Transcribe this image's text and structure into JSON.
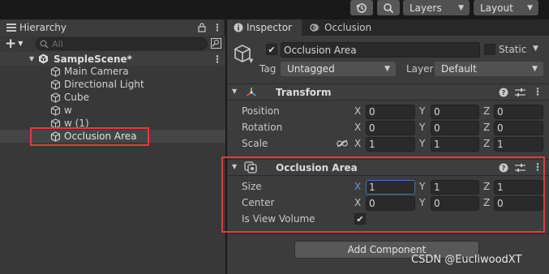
{
  "toolbar": {
    "history_icon": "history-icon",
    "search_icon": "search-icon",
    "layers_label": "Layers",
    "layout_label": "Layout"
  },
  "hierarchy": {
    "tab_label": "Hierarchy",
    "search_placeholder": "All",
    "scene_name": "SampleScene*",
    "items": [
      {
        "label": "Main Camera"
      },
      {
        "label": "Directional Light"
      },
      {
        "label": "Cube"
      },
      {
        "label": "w"
      },
      {
        "label": "w (1)"
      },
      {
        "label": "Occlusion Area"
      }
    ]
  },
  "inspector": {
    "tab_label": "Inspector",
    "tab2_label": "Occlusion",
    "object_name": "Occlusion Area",
    "static_label": "Static",
    "tag_label": "Tag",
    "tag_value": "Untagged",
    "layer_label": "Layer",
    "layer_value": "Default",
    "transform": {
      "title": "Transform",
      "rows": [
        {
          "label": "Position",
          "x": "0",
          "y": "0",
          "z": "0"
        },
        {
          "label": "Rotation",
          "x": "0",
          "y": "0",
          "z": "0"
        },
        {
          "label": "Scale",
          "x": "1",
          "y": "1",
          "z": "1"
        }
      ]
    },
    "occlusion_area": {
      "title": "Occlusion Area",
      "rows": [
        {
          "label": "Size",
          "x": "1",
          "y": "1",
          "z": "1"
        },
        {
          "label": "Center",
          "x": "0",
          "y": "0",
          "z": "0"
        }
      ],
      "view_volume_label": "Is View Volume"
    },
    "axis": {
      "x": "X",
      "y": "Y",
      "z": "Z"
    },
    "add_component_label": "Add Component"
  },
  "watermark": "CSDN @EucliwoodXT",
  "colors": {
    "highlight_red": "#e03c3c",
    "selected_field_border": "#3a79bb",
    "selected_axis": "#5b9bd5"
  }
}
